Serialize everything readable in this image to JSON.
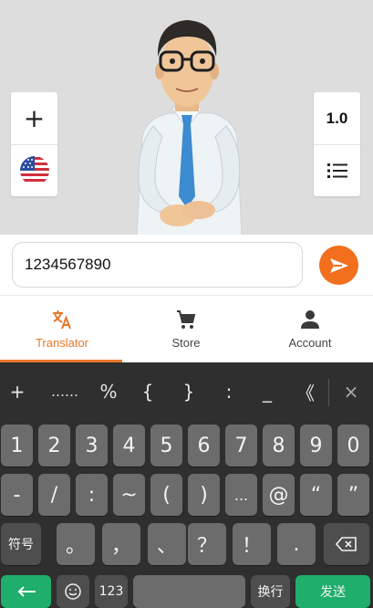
{
  "avatar": {
    "plus_label": "+",
    "speed_label": "1.0"
  },
  "input": {
    "value": "1234567890"
  },
  "tabs": [
    {
      "label": "Translator",
      "icon": "translate-icon",
      "active": true
    },
    {
      "label": "Store",
      "icon": "cart-icon",
      "active": false
    },
    {
      "label": "Account",
      "icon": "person-icon",
      "active": false
    }
  ],
  "colors": {
    "accent": "#f26f1d",
    "tab_active": "#e8772a",
    "keyboard_bg": "#2f2f2f",
    "key_bg": "#6c6c6c",
    "green": "#1fae6b"
  },
  "keyboard": {
    "symbols": [
      "+",
      "……",
      "%",
      "{",
      "}",
      ":",
      "_",
      "《",
      "×"
    ],
    "row1": [
      "1",
      "2",
      "3",
      "4",
      "5",
      "6",
      "7",
      "8",
      "9",
      "0"
    ],
    "row2": [
      "-",
      "/",
      ":",
      "~",
      "(",
      ")",
      "...",
      "@",
      "“",
      "”"
    ],
    "row3": [
      "符号",
      "。",
      "，",
      "、",
      "？",
      "！",
      "."
    ],
    "row4": {
      "numbers_label": "123",
      "switch_label": "换行",
      "send_label": "发送"
    }
  }
}
